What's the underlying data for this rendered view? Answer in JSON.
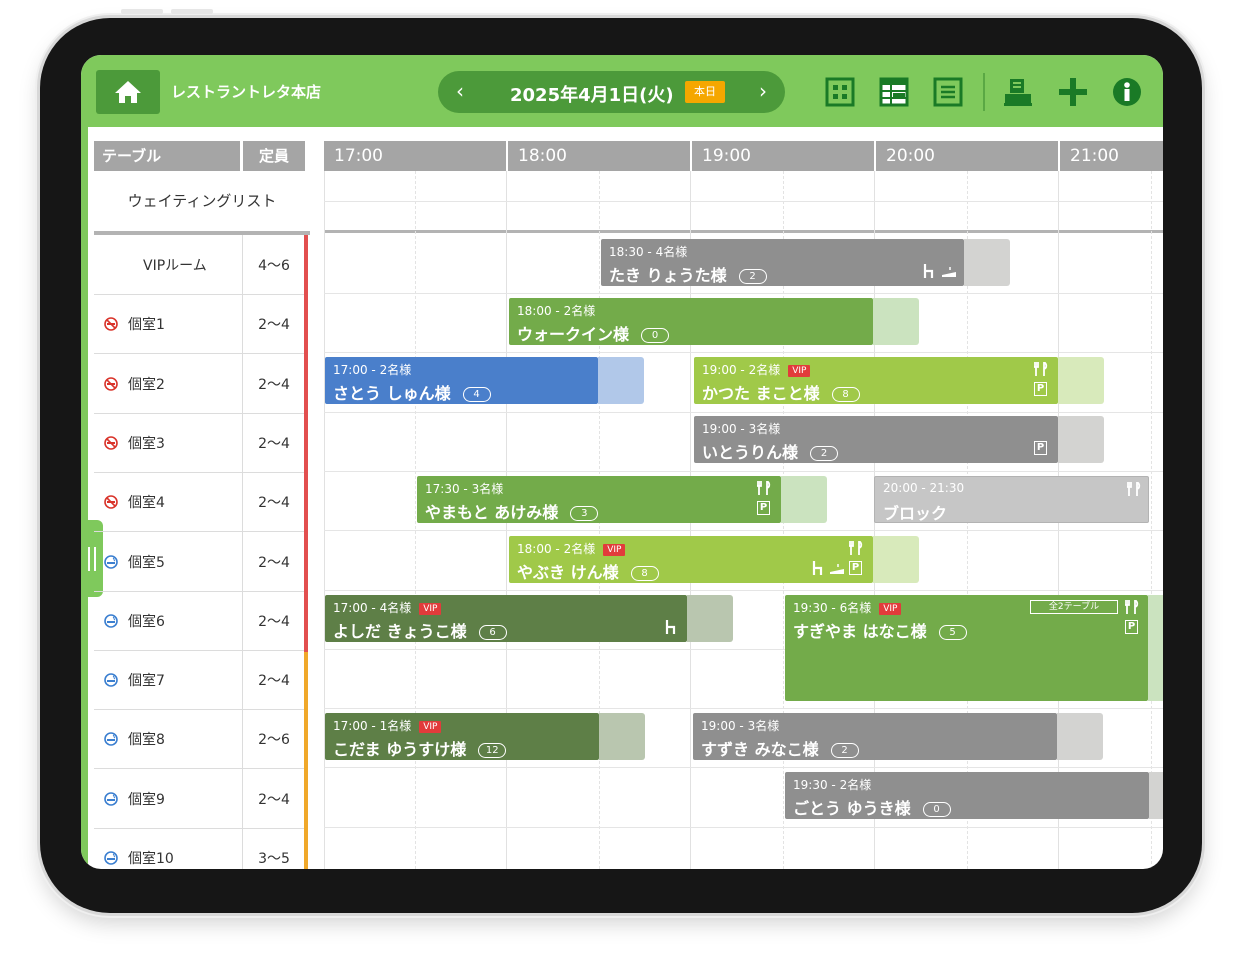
{
  "header": {
    "store_name": "レストラントレタ本店",
    "date": "2025年4月1日(火)",
    "today": "本日",
    "prev": "‹",
    "next": "›"
  },
  "table_header": {
    "table": "テーブル",
    "capacity": "定員"
  },
  "waiting_list": "ウェイティングリスト",
  "hours": [
    "17:00",
    "18:00",
    "19:00",
    "20:00",
    "21:00"
  ],
  "tables": [
    {
      "name": "VIPルーム",
      "capacity": "4～6",
      "smoking": "none"
    },
    {
      "name": "個室1",
      "capacity": "2～4",
      "smoking": "no"
    },
    {
      "name": "個室2",
      "capacity": "2～4",
      "smoking": "no"
    },
    {
      "name": "個室3",
      "capacity": "2～4",
      "smoking": "no"
    },
    {
      "name": "個室4",
      "capacity": "2～4",
      "smoking": "no"
    },
    {
      "name": "個室5",
      "capacity": "2～4",
      "smoking": "yes"
    },
    {
      "name": "個室6",
      "capacity": "2～4",
      "smoking": "yes"
    },
    {
      "name": "個室7",
      "capacity": "2～4",
      "smoking": "yes"
    },
    {
      "name": "個室8",
      "capacity": "2～6",
      "smoking": "yes"
    },
    {
      "name": "個室9",
      "capacity": "2～4",
      "smoking": "yes"
    },
    {
      "name": "個室10",
      "capacity": "3～5",
      "smoking": "yes"
    }
  ],
  "reservations": {
    "r0": {
      "time": "18:30",
      "party": "- 4名様",
      "name": "たき りょうた様",
      "count": "2"
    },
    "r1": {
      "time": "18:00",
      "party": "- 2名様",
      "name": "ウォークイン様",
      "count": "0"
    },
    "r2a": {
      "time": "17:00",
      "party": "- 2名様",
      "name": "さとう しゅん様",
      "count": "4"
    },
    "r2b": {
      "time": "19:00",
      "party": "- 2名様",
      "vip": "VIP",
      "name": "かつた まこと様",
      "count": "8"
    },
    "r3": {
      "time": "19:00",
      "party": "- 3名様",
      "name": "いとうりん様",
      "count": "2"
    },
    "r4a": {
      "time": "17:30",
      "party": "- 3名様",
      "name": "やまもと あけみ様",
      "count": "3"
    },
    "r4b": {
      "time": "20:00 - 21:30",
      "name": "ブロック"
    },
    "r5": {
      "time": "18:00",
      "party": "- 2名様",
      "vip": "VIP",
      "name": "やぶき けん様",
      "count": "8"
    },
    "r6a": {
      "time": "17:00",
      "party": "- 4名様",
      "vip": "VIP",
      "name": "よしだ きょうこ様",
      "count": "6"
    },
    "r6b": {
      "time": "19:30",
      "party": "- 6名様",
      "vip": "VIP",
      "name": "すぎやま はなこ様",
      "count": "5",
      "tag": "全2テーブル"
    },
    "r8a": {
      "time": "17:00",
      "party": "- 1名様",
      "vip": "VIP",
      "name": "こだま ゆうすけ様",
      "count": "12"
    },
    "r8b": {
      "time": "19:00",
      "party": "- 3名様",
      "name": "すずき みなこ様",
      "count": "2"
    },
    "r9": {
      "time": "19:30",
      "party": "- 2名様",
      "name": "ごとう ゆうき様",
      "count": "0"
    }
  },
  "icons": {
    "parking": "P",
    "toolbar": [
      "layout-icon",
      "grid-icon",
      "list-icon",
      "register-icon",
      "add-icon",
      "info-icon"
    ]
  },
  "colors": {
    "header_green": "#7fc95c",
    "dark_green": "#4c9a3a",
    "today_badge": "#f5a700",
    "vip_red": "#e23b3b",
    "blue_block": "#4a7fcb",
    "gray_block": "#8f8f8f"
  }
}
